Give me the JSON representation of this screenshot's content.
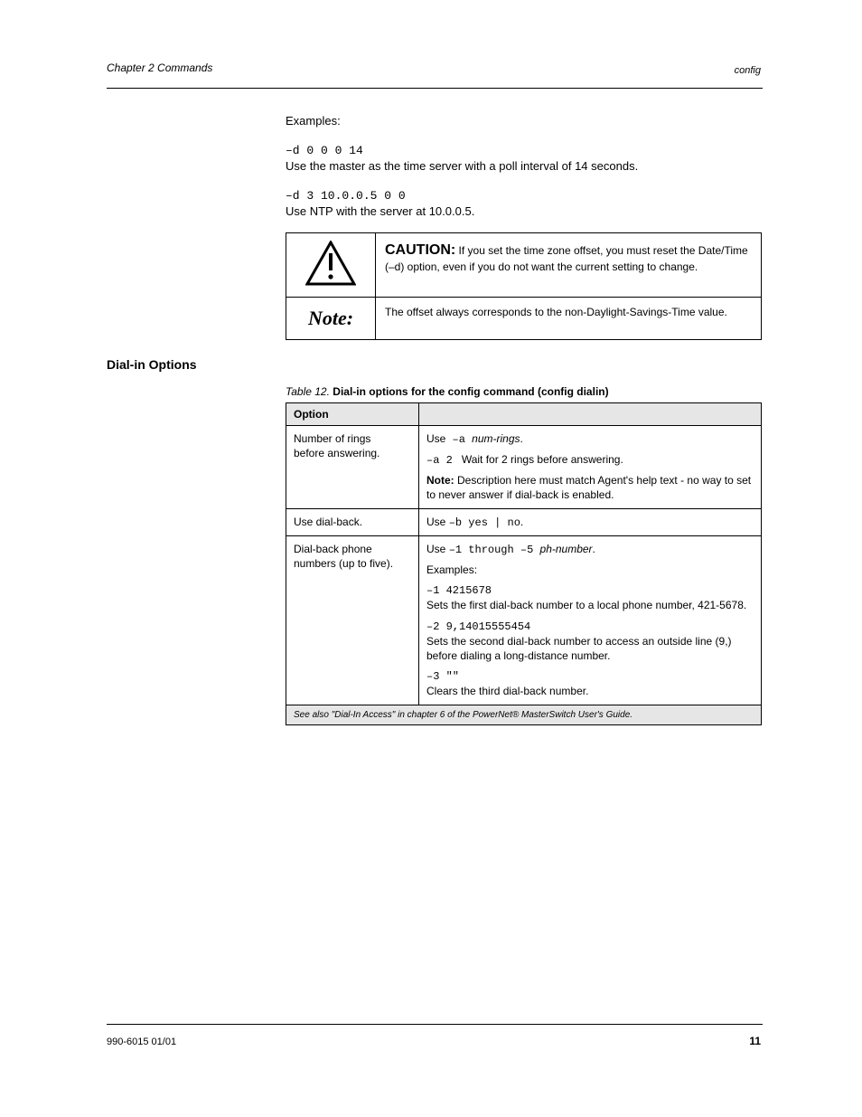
{
  "header": {
    "chapter": "Chapter 2      Commands",
    "section": "config"
  },
  "para_examples_intro": "Examples:",
  "para_example1_line1": "–d 0 0 0 14",
  "para_example1_line2": "Use the master as the time server with a poll interval of 14 seconds.",
  "para_example2_line1": "–d 3 10.0.0.5 0 0",
  "para_example2_line2": "Use NTP with the server at 10.0.0.5.",
  "tbl1": {
    "caution_label": "CAUTION:",
    "caution_text": " If you set the time zone offset, you must reset the Date/Time (–d) option, even if you do not want the current setting to change.",
    "note_label": "Note:",
    "note_text": " The offset always corresponds to the non-Daylight-Savings-Time value."
  },
  "h_dialin": "Dial-in Options",
  "table_caption_num": "Table 12.",
  "table_caption_name": "Dial-in options for the config command (config dialin)",
  "tbl2": {
    "h1": "Option",
    "h2": "",
    "r1c1": "Number of rings\nbefore answering.",
    "r1c2_line1_prefix": "Use",
    "r1c2_line1_code": " –a ",
    "r1c2_line1_italic": "num-rings",
    "r1c2_line1_suffix": ".",
    "r1c2_example_code": "–a 2",
    "r1c2_example_suffix": " Wait for 2 rings before answering.",
    "r1c2_note_label": "Note:",
    "r1c2_note_text": " Description here must match Agent's help text - no way to set to never answer if dial-back is enabled.",
    "r2c1": "Use dial-back.",
    "r2c2_prefix": "Use ",
    "r2c2_code": "–b yes | no",
    "r2c2_suffix": ".",
    "r3c1": "Dial-back phone numbers (up to five).",
    "r3c2_line1_prefix": "Use ",
    "r3c2_line1_code": "–1 through –5 ",
    "r3c2_line1_italic": "ph-number",
    "r3c2_line1_suffix": ".",
    "r3c2_line2": "Examples:",
    "r3c2_ex1_code": "–1 4215678",
    "r3c2_ex1_txt": "Sets the first dial-back number to a local phone number, 421-5678.",
    "r3c2_ex2_code": "–2 9,14015555454",
    "r3c2_ex2_txt": "Sets the second dial-back number to access an outside line (9,) before dialing a long-distance number.",
    "r3c2_ex3_code": "–3 \"\"",
    "r3c2_ex3_txt": "Clears the third dial-back number.",
    "foot": "See also \"Dial-In Access\" in chapter 6 of the PowerNet® MasterSwitch User's Guide."
  },
  "footer": {
    "pub": "990-6015    01/01",
    "page": "11"
  }
}
